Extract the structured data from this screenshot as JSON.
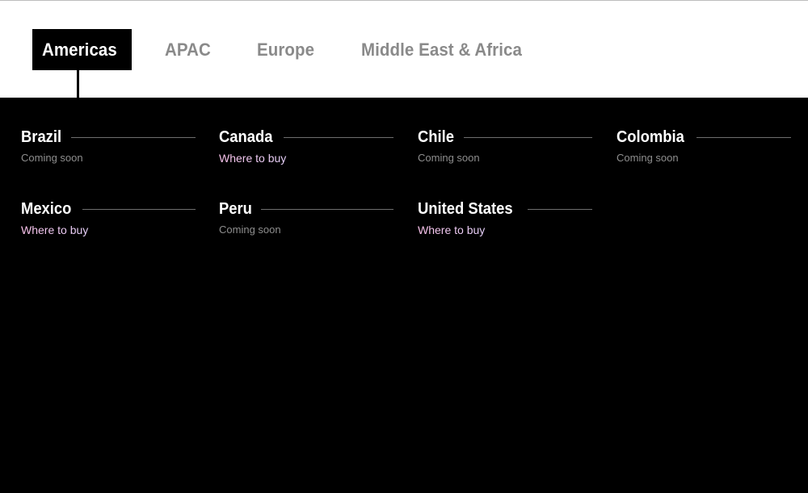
{
  "tabs": [
    {
      "label": "Americas",
      "active": true
    },
    {
      "label": "APAC",
      "active": false
    },
    {
      "label": "Europe",
      "active": false
    },
    {
      "label": "Middle East & Africa",
      "active": false
    }
  ],
  "countries": [
    {
      "name": "Brazil",
      "status": "Coming soon",
      "available": false
    },
    {
      "name": "Canada",
      "status": "Where to buy",
      "available": true
    },
    {
      "name": "Chile",
      "status": "Coming soon",
      "available": false
    },
    {
      "name": "Colombia",
      "status": "Coming soon",
      "available": false
    },
    {
      "name": "Mexico",
      "status": "Where to buy",
      "available": true
    },
    {
      "name": "Peru",
      "status": "Coming soon",
      "available": false
    },
    {
      "name": "United States",
      "status": "Where to buy",
      "available": true
    }
  ],
  "colors": {
    "active_tab_bg": "#000000",
    "inactive_tab_text": "#8a8a8a",
    "link_gradient_start": "#ffc6f0",
    "link_gradient_end": "#c8f3ea"
  }
}
